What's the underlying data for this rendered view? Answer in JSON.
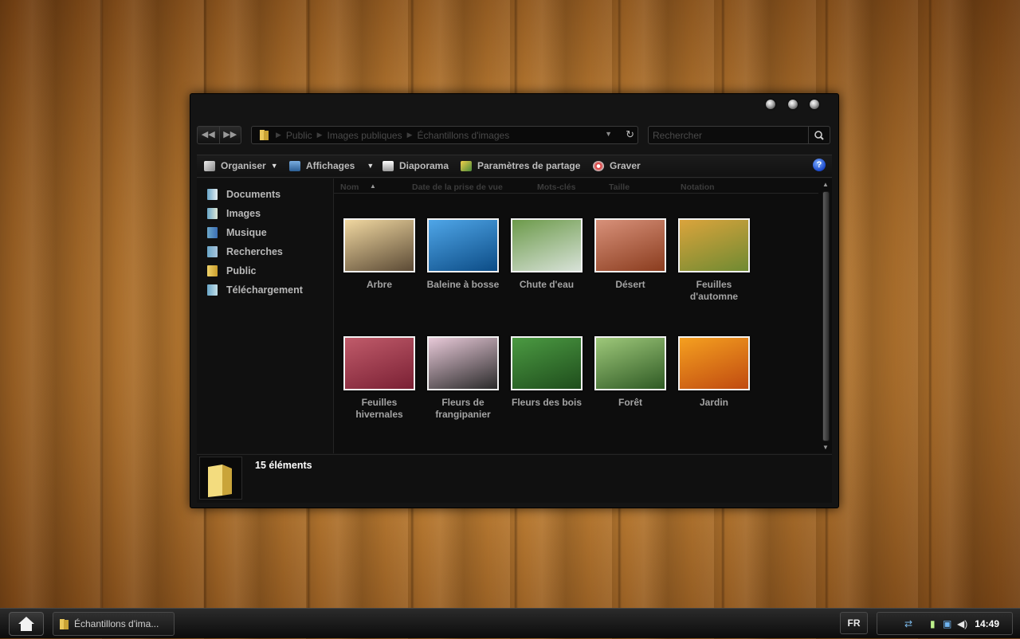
{
  "window": {
    "address": {
      "crumbs": [
        "Public",
        "Images publiques",
        "Échantillons d'images"
      ]
    },
    "search": {
      "placeholder": "Rechercher"
    },
    "toolbar": {
      "organize": "Organiser",
      "views": "Affichages",
      "slideshow": "Diaporama",
      "share": "Paramètres de partage",
      "burn": "Graver",
      "help": "?"
    },
    "sidebar": {
      "items": [
        {
          "label": "Documents",
          "icon": "documents-icon"
        },
        {
          "label": "Images",
          "icon": "images-icon"
        },
        {
          "label": "Musique",
          "icon": "music-icon"
        },
        {
          "label": "Recherches",
          "icon": "search-folder-icon"
        },
        {
          "label": "Public",
          "icon": "folder-icon"
        },
        {
          "label": "Téléchargement",
          "icon": "downloads-icon"
        }
      ]
    },
    "columns": [
      "Nom",
      "Date de la prise de vue",
      "Mots-clés",
      "Taille",
      "Notation"
    ],
    "files": [
      {
        "name": "Arbre",
        "colors": [
          "#f0d7a0",
          "#5b4a35"
        ]
      },
      {
        "name": "Baleine à bosse",
        "colors": [
          "#4fa6e8",
          "#0c4c86"
        ]
      },
      {
        "name": "Chute d'eau",
        "colors": [
          "#6c9a4a",
          "#d8e2d8"
        ]
      },
      {
        "name": "Désert",
        "colors": [
          "#d8917a",
          "#8a3c1e"
        ]
      },
      {
        "name": "Feuilles d'automne",
        "colors": [
          "#dba43c",
          "#6f8a32"
        ]
      },
      {
        "name": "Feuilles hivernales",
        "colors": [
          "#c05b6a",
          "#7a2034"
        ]
      },
      {
        "name": "Fleurs de frangipanier",
        "colors": [
          "#e8c9d8",
          "#2a2a2a"
        ]
      },
      {
        "name": "Fleurs des bois",
        "colors": [
          "#4b9a42",
          "#1f4d1c"
        ]
      },
      {
        "name": "Forêt",
        "colors": [
          "#9ec87a",
          "#2f5a24"
        ]
      },
      {
        "name": "Jardin",
        "colors": [
          "#f5a020",
          "#c04a10"
        ]
      }
    ],
    "status": {
      "count": "15 éléments"
    }
  },
  "taskbar": {
    "task_label": "Échantillons d'ima...",
    "lang": "FR",
    "clock": "14:49"
  }
}
